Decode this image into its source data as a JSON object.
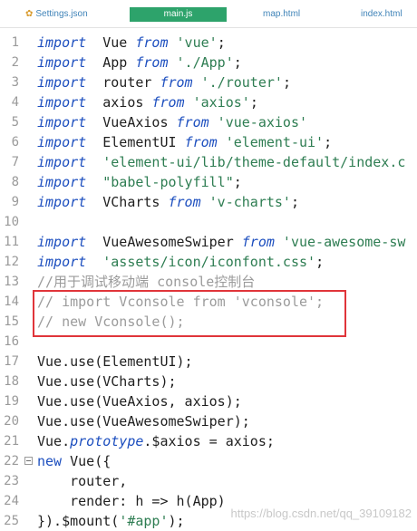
{
  "tabs": [
    {
      "label": "Settings.json",
      "icon": "gear-icon"
    },
    {
      "label": "main.js",
      "active": true
    },
    {
      "label": "map.html"
    },
    {
      "label": "index.html"
    }
  ],
  "lines": [
    {
      "n": "1",
      "tokens": [
        [
          "kw",
          "import"
        ],
        [
          "",
          "  Vue "
        ],
        [
          "kw",
          "from"
        ],
        [
          "str",
          " 'vue'"
        ],
        [
          "",
          ";"
        ]
      ]
    },
    {
      "n": "2",
      "tokens": [
        [
          "kw",
          "import"
        ],
        [
          "",
          "  App "
        ],
        [
          "kw",
          "from"
        ],
        [
          "str",
          " './App'"
        ],
        [
          "",
          ";"
        ]
      ]
    },
    {
      "n": "3",
      "tokens": [
        [
          "kw",
          "import"
        ],
        [
          "",
          "  router "
        ],
        [
          "kw",
          "from"
        ],
        [
          "str",
          " './router'"
        ],
        [
          "",
          ";"
        ]
      ]
    },
    {
      "n": "4",
      "tokens": [
        [
          "kw",
          "import"
        ],
        [
          "",
          "  axios "
        ],
        [
          "kw",
          "from"
        ],
        [
          "str",
          " 'axios'"
        ],
        [
          "",
          ";"
        ]
      ]
    },
    {
      "n": "5",
      "tokens": [
        [
          "kw",
          "import"
        ],
        [
          "",
          "  VueAxios "
        ],
        [
          "kw",
          "from"
        ],
        [
          "str",
          " 'vue-axios'"
        ]
      ]
    },
    {
      "n": "6",
      "tokens": [
        [
          "kw",
          "import"
        ],
        [
          "",
          "  ElementUI "
        ],
        [
          "kw",
          "from"
        ],
        [
          "str",
          " 'element-ui'"
        ],
        [
          "",
          ";"
        ]
      ]
    },
    {
      "n": "7",
      "tokens": [
        [
          "kw",
          "import"
        ],
        [
          "str",
          "  'element-ui/lib/theme-default/index.c"
        ]
      ]
    },
    {
      "n": "8",
      "tokens": [
        [
          "kw",
          "import"
        ],
        [
          "str",
          "  \"babel-polyfill\""
        ],
        [
          "",
          ";"
        ]
      ]
    },
    {
      "n": "9",
      "tokens": [
        [
          "kw",
          "import"
        ],
        [
          "",
          "  VCharts "
        ],
        [
          "kw",
          "from"
        ],
        [
          "str",
          " 'v-charts'"
        ],
        [
          "",
          ";"
        ]
      ]
    },
    {
      "n": "10",
      "tokens": []
    },
    {
      "n": "11",
      "tokens": [
        [
          "kw",
          "import"
        ],
        [
          "",
          "  VueAwesomeSwiper "
        ],
        [
          "kw",
          "from"
        ],
        [
          "str",
          " 'vue-awesome-sw"
        ]
      ]
    },
    {
      "n": "12",
      "tokens": [
        [
          "kw",
          "import"
        ],
        [
          "str",
          "  'assets/icon/iconfont.css'"
        ],
        [
          "",
          ";"
        ]
      ]
    },
    {
      "n": "13",
      "tokens": [
        [
          "cm",
          "//用于调试移动端 console控制台"
        ]
      ]
    },
    {
      "n": "14",
      "tokens": [
        [
          "cm",
          "// import Vconsole from 'vconsole';"
        ]
      ]
    },
    {
      "n": "15",
      "tokens": [
        [
          "cm",
          "// new Vconsole();"
        ]
      ]
    },
    {
      "n": "16",
      "tokens": []
    },
    {
      "n": "17",
      "tokens": [
        [
          "",
          "Vue.use(ElementUI);"
        ]
      ]
    },
    {
      "n": "18",
      "tokens": [
        [
          "",
          "Vue.use(VCharts);"
        ]
      ]
    },
    {
      "n": "19",
      "tokens": [
        [
          "",
          "Vue.use(VueAxios, axios);"
        ]
      ]
    },
    {
      "n": "20",
      "tokens": [
        [
          "",
          "Vue.use(VueAwesomeSwiper);"
        ]
      ]
    },
    {
      "n": "21",
      "tokens": [
        [
          "",
          "Vue."
        ],
        [
          "it",
          "prototype"
        ],
        [
          "",
          ".$axios = axios;"
        ]
      ]
    },
    {
      "n": "22",
      "fold": true,
      "tokens": [
        [
          "kw2",
          "new"
        ],
        [
          "",
          " Vue({"
        ]
      ]
    },
    {
      "n": "23",
      "tokens": [
        [
          "",
          "    router,"
        ]
      ]
    },
    {
      "n": "24",
      "tokens": [
        [
          "",
          "    render: h => h(App)"
        ]
      ]
    },
    {
      "n": "25",
      "tokens": [
        [
          "",
          "}).$mount("
        ],
        [
          "str",
          "'#app'"
        ],
        [
          "",
          ");"
        ]
      ]
    }
  ],
  "watermark": "https://blog.csdn.net/qq_39109182"
}
